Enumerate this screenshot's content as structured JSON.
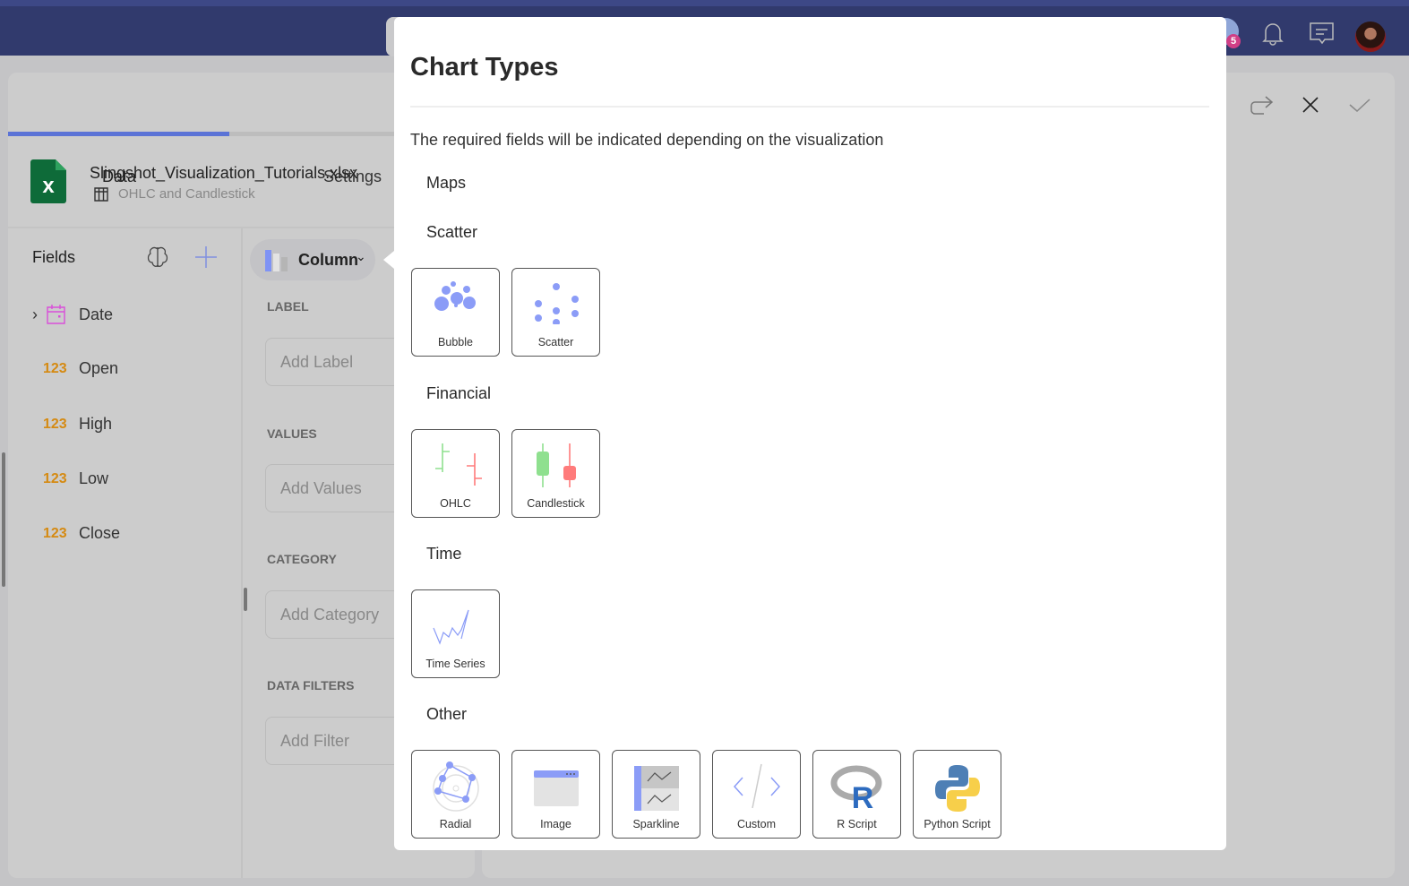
{
  "header": {
    "badge_count": "5",
    "icons": [
      "user-avatar-badge",
      "bell-icon",
      "message-icon",
      "profile-avatar"
    ]
  },
  "editor": {
    "tabs": [
      {
        "label": "Data",
        "active": true
      },
      {
        "label": "Settings",
        "active": false
      }
    ],
    "file": {
      "name": "Slingshot_Visualization_Tutorials.xlsx",
      "sheet": "OHLC and Candlestick"
    },
    "fields_title": "Fields",
    "fields": [
      {
        "type": "date",
        "label": "Date"
      },
      {
        "type": "123",
        "label": "Open"
      },
      {
        "type": "123",
        "label": "High"
      },
      {
        "type": "123",
        "label": "Low"
      },
      {
        "type": "123",
        "label": "Close"
      }
    ],
    "viz_selector": "Column",
    "sections": [
      {
        "title": "LABEL",
        "placeholder": "Add Label"
      },
      {
        "title": "VALUES",
        "placeholder": "Add Values"
      },
      {
        "title": "CATEGORY",
        "placeholder": "Add Category"
      },
      {
        "title": "DATA FILTERS",
        "placeholder": "Add Filter"
      }
    ]
  },
  "modal": {
    "title": "Chart Types",
    "description": "The required fields will be indicated depending on the visualization",
    "categories": [
      {
        "name": "Maps",
        "items": []
      },
      {
        "name": "Scatter",
        "items": [
          "Bubble",
          "Scatter"
        ]
      },
      {
        "name": "Financial",
        "items": [
          "OHLC",
          "Candlestick"
        ]
      },
      {
        "name": "Time",
        "items": [
          "Time Series"
        ]
      },
      {
        "name": "Other",
        "items": [
          "Radial",
          "Image",
          "Sparkline",
          "Custom",
          "R Script",
          "Python Script"
        ]
      }
    ]
  },
  "colors": {
    "header": "#313a6d",
    "accent": "#5b73d6",
    "icon_blue": "#8b9cf7",
    "green": "#8fe08f",
    "red": "#ff7b7b",
    "number_type": "#d58a12",
    "date_type": "#d94fd9"
  }
}
